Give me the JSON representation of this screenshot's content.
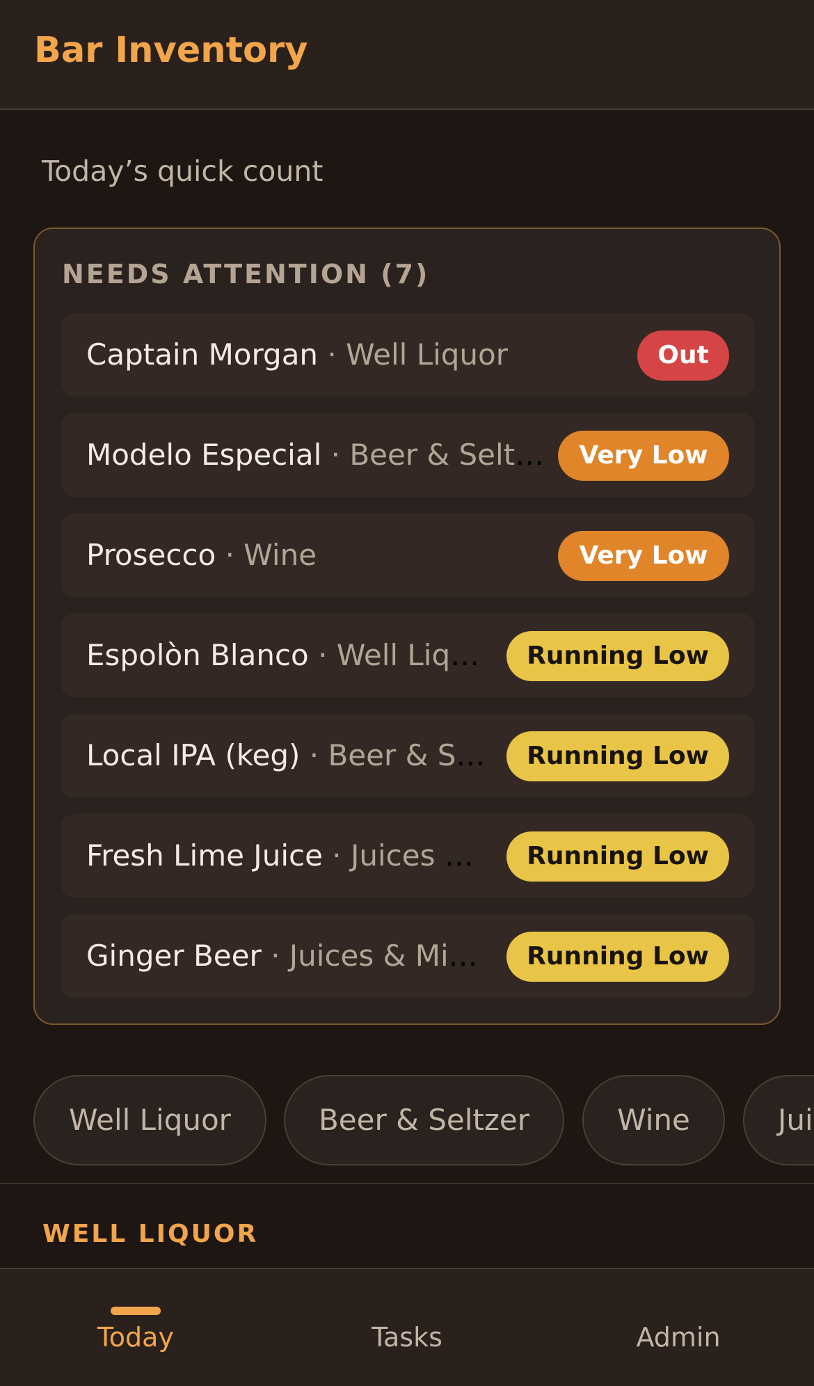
{
  "header": {
    "title": "Bar Inventory"
  },
  "subtitle": "Today’s quick count",
  "attention": {
    "heading": "NEEDS ATTENTION (7)",
    "items": [
      {
        "name": "Captain Morgan",
        "separator": " · ",
        "category": "Well Liquor",
        "status": "Out"
      },
      {
        "name": "Modelo Especial",
        "separator": " · ",
        "category": "Beer & Seltzer",
        "status": "Very Low"
      },
      {
        "name": "Prosecco",
        "separator": " · ",
        "category": "Wine",
        "status": "Very Low"
      },
      {
        "name": "Espolòn Blanco",
        "separator": " · ",
        "category": "Well Liquor",
        "status": "Running Low"
      },
      {
        "name": "Local IPA (keg)",
        "separator": " · ",
        "category": "Beer & Seltzer",
        "status": "Running Low"
      },
      {
        "name": "Fresh Lime Juice",
        "separator": " · ",
        "category": "Juices & Mixers",
        "status": "Running Low"
      },
      {
        "name": "Ginger Beer",
        "separator": " · ",
        "category": "Juices & Mixers",
        "status": "Running Low"
      }
    ]
  },
  "status_colors": {
    "Out": {
      "bg": "#d64545",
      "fg": "#ffffff"
    },
    "Very Low": {
      "bg": "#e0852a",
      "fg": "#ffffff"
    },
    "Running Low": {
      "bg": "#e8c547",
      "fg": "#1a1410"
    }
  },
  "filters": [
    "Well Liquor",
    "Beer & Seltzer",
    "Wine",
    "Juices & Mixers"
  ],
  "section": {
    "heading": "WELL LIQUOR"
  },
  "nav": [
    {
      "label": "Today",
      "active": true
    },
    {
      "label": "Tasks",
      "active": false
    },
    {
      "label": "Admin",
      "active": false
    }
  ],
  "theme": {
    "accent": "#f2a54a",
    "background": "#1d1613",
    "surface": "#2a211d",
    "card_border": "#7b5a2f"
  }
}
